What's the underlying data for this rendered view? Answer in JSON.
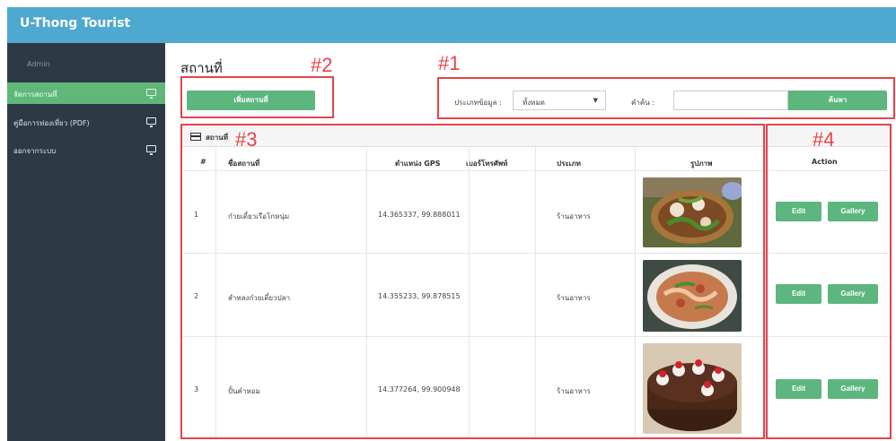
{
  "header": {
    "brand": "U-Thong Tourist"
  },
  "sidebar": {
    "role": "Admin",
    "items": [
      {
        "label": "จัดการสถานที่",
        "active": true,
        "icon": "monitor-icon"
      },
      {
        "label": "คู่มือการท่องเที่ยว (PDF)",
        "active": false,
        "icon": "monitor-icon"
      },
      {
        "label": "ออกจากระบบ",
        "active": false,
        "icon": "monitor-icon"
      }
    ]
  },
  "page": {
    "title": "สถานที่",
    "add_button": "เพิ่มสถานที่"
  },
  "filter": {
    "type_label": "ประเภทข้อมูล :",
    "type_value": "ทั้งหมด",
    "keyword_label": "คำค้น :",
    "keyword_value": "",
    "search_button": "ค้นหา"
  },
  "annotations": {
    "a1": "#1",
    "a2": "#2",
    "a3": "#3",
    "a4": "#4"
  },
  "table": {
    "title": "สถานที่",
    "columns": [
      "#",
      "ชื่อสถานที่",
      "ตำแหน่ง GPS",
      "เบอร์โทรศัพท์",
      "ประเภท",
      "รูปภาพ",
      "Action"
    ],
    "rows": [
      {
        "num": "1",
        "name": "ก๋วยเตี๋ยวเรือโกหนุ่ม",
        "gps": "14.365337, 99.888011",
        "phone": "",
        "type": "ร้านอาหาร",
        "edit": "Edit",
        "gallery": "Gallery"
      },
      {
        "num": "2",
        "name": "สำหลงก๋วยเตี๋ยวปลา",
        "gps": "14.355233, 99.878515",
        "phone": "",
        "type": "ร้านอาหาร",
        "edit": "Edit",
        "gallery": "Gallery"
      },
      {
        "num": "3",
        "name": "ปั้นคำหอม",
        "gps": "14.377264, 99.900948",
        "phone": "",
        "type": "ร้านอาหาร",
        "edit": "Edit",
        "gallery": "Gallery"
      }
    ]
  },
  "colors": {
    "topbar": "#4ea8cf",
    "sidebar": "#2d3a46",
    "accent_green": "#5cb67e",
    "annotation_red": "#e8424a"
  }
}
